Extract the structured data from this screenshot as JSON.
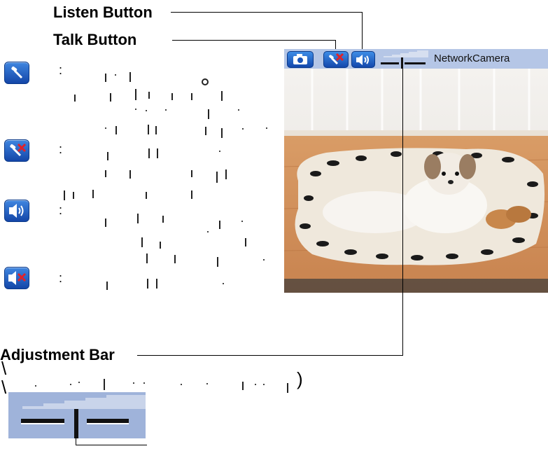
{
  "callouts": {
    "listen": "Listen Button",
    "talk": "Talk Button",
    "adjustment": "Adjustment Bar"
  },
  "legend": [
    {
      "icon": "microphone-icon",
      "colon": ":"
    },
    {
      "icon": "microphone-muted-icon",
      "colon": ":"
    },
    {
      "icon": "speaker-icon",
      "colon": ":"
    },
    {
      "icon": "speaker-muted-icon",
      "colon": ":"
    }
  ],
  "camera_view": {
    "title": "NetworkCamera",
    "buttons": [
      "camera-snapshot-icon",
      "talk-muted-icon",
      "listen-speaker-icon"
    ]
  },
  "caption_fragments": {
    "left": "\\",
    "left2": "\\",
    "right": ")"
  },
  "colors": {
    "button_blue": "#1f5fc4",
    "toolbar_bg": "#b5c6e6",
    "mute_red": "#e0222a"
  }
}
